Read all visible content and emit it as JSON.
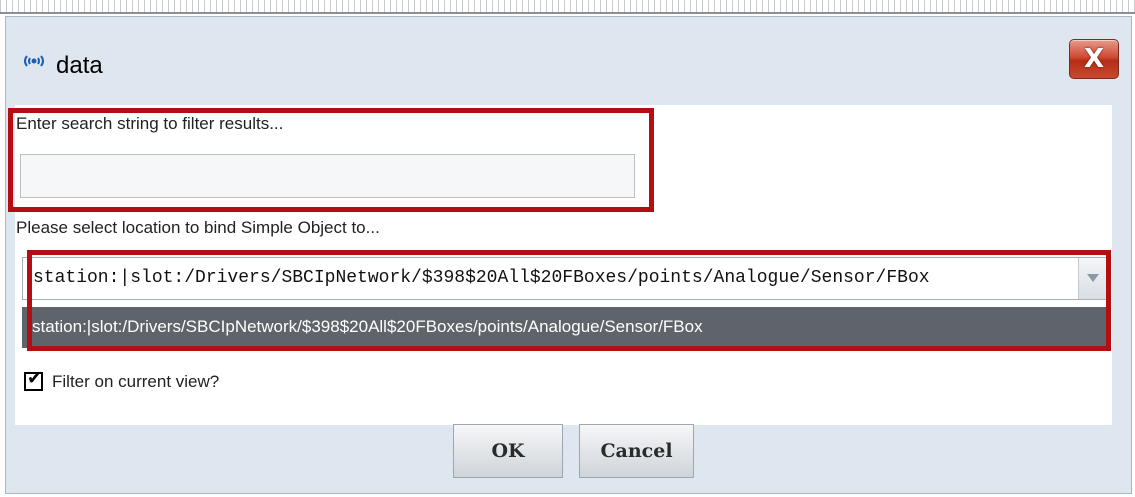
{
  "window": {
    "title": "data",
    "close_label": "X"
  },
  "search": {
    "prompt": "Enter search string to filter results...",
    "value": "",
    "placeholder": ""
  },
  "location": {
    "prompt": "Please select location to bind Simple Object to...",
    "selected": "station:|slot:/Drivers/SBCIpNetwork/$398$20All$20FBoxes/points/Analogue/Sensor/FBox",
    "options": [
      "station:|slot:/Drivers/SBCIpNetwork/$398$20All$20FBoxes/points/Analogue/Sensor/FBox"
    ]
  },
  "filter": {
    "label": "Filter on current view?",
    "checked": true
  },
  "buttons": {
    "ok_label": "OK",
    "cancel_label": "Cancel"
  },
  "icons": {
    "app": "broadcast-icon",
    "close": "close-icon",
    "dropdown": "chevron-down-icon",
    "check": "checkmark-icon"
  },
  "colors": {
    "highlight": "#b50e12",
    "close_button": "#c8412b",
    "selected_row": "#5f646b",
    "dialog_background": "#dee6ef"
  }
}
